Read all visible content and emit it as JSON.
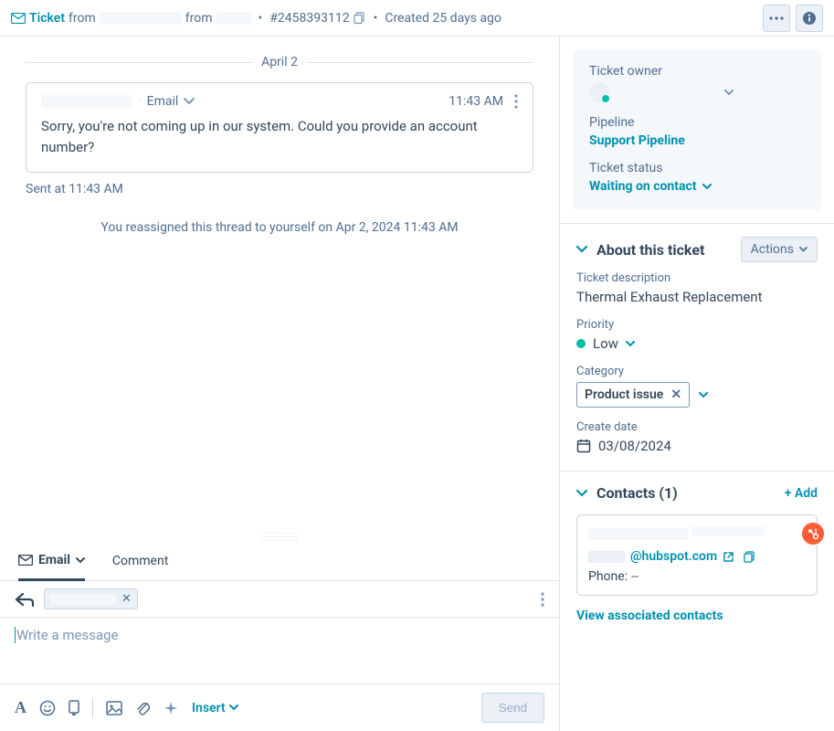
{
  "header": {
    "ticket_label": "Ticket",
    "from1": "from",
    "from2": "from",
    "ticket_number": "#2458393112",
    "created": "Created 25 days ago",
    "dot": "•"
  },
  "thread": {
    "date": "April 2",
    "message": {
      "channel": "Email",
      "time": "11:43 AM",
      "body": "Sorry, you're not coming up in our system. Could you provide an account number?"
    },
    "sent_line": "Sent at 11:43 AM",
    "reassign_line": "You reassigned this thread to yourself on Apr 2, 2024 11:43 AM"
  },
  "compose": {
    "tab_email": "Email",
    "tab_comment": "Comment",
    "placeholder": "Write a message",
    "insert": "Insert",
    "send": "Send"
  },
  "sidebar": {
    "owner": {
      "label": "Ticket owner",
      "pipeline_label": "Pipeline",
      "pipeline_value": "Support Pipeline",
      "status_label": "Ticket status",
      "status_value": "Waiting on contact"
    },
    "about": {
      "title": "About this ticket",
      "actions": "Actions",
      "desc_label": "Ticket description",
      "desc_value": "Thermal Exhaust Replacement",
      "priority_label": "Priority",
      "priority_value": "Low",
      "category_label": "Category",
      "category_value": "Product issue",
      "create_label": "Create date",
      "create_value": "03/08/2024"
    },
    "contacts": {
      "title": "Contacts (1)",
      "add": "+ Add",
      "email_domain": "@hubspot.com",
      "phone_label": "Phone:",
      "phone_value": "--",
      "view": "View associated contacts"
    }
  }
}
